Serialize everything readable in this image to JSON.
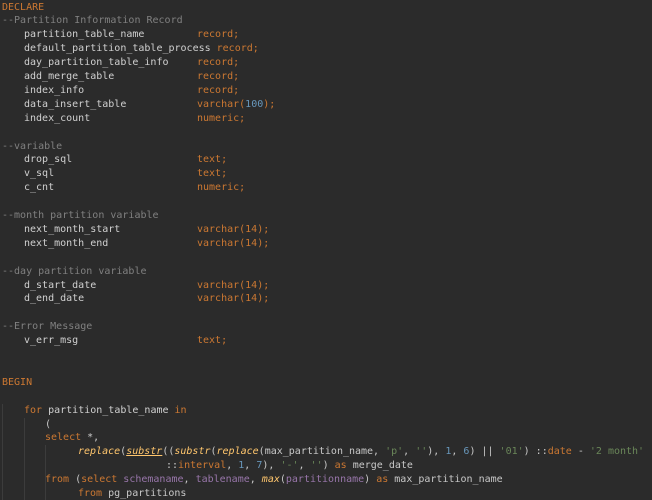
{
  "colors": {
    "background": "#2b2b2b",
    "keyword": "#cc7832",
    "comment": "#808080",
    "identifier": "#d0d0d0",
    "function": "#ffc66d",
    "string": "#6a8759",
    "number": "#6897bb",
    "field": "#9876aa"
  },
  "lines": [
    {
      "indent": 0,
      "tokens": [
        {
          "t": "kw",
          "v": "DECLARE"
        }
      ]
    },
    {
      "indent": 0,
      "tokens": [
        {
          "t": "comment",
          "v": "--Partition Information Record"
        }
      ]
    },
    {
      "indent": 1,
      "tokens": [
        {
          "t": "ident",
          "v": "partition_table_name"
        },
        {
          "t": "pad",
          "v": "record"
        },
        {
          "t": "type",
          "v": "record;"
        }
      ]
    },
    {
      "indent": 1,
      "tokens": [
        {
          "t": "ident",
          "v": "default_partition_table_process"
        },
        {
          "t": "pad",
          "v": "record"
        },
        {
          "t": "type",
          "v": "record;"
        }
      ]
    },
    {
      "indent": 1,
      "tokens": [
        {
          "t": "ident",
          "v": "day_partition_table_info"
        },
        {
          "t": "pad",
          "v": "record"
        },
        {
          "t": "type",
          "v": "record;"
        }
      ]
    },
    {
      "indent": 1,
      "tokens": [
        {
          "t": "ident",
          "v": "add_merge_table"
        },
        {
          "t": "pad",
          "v": "record"
        },
        {
          "t": "type",
          "v": "record;"
        }
      ]
    },
    {
      "indent": 1,
      "tokens": [
        {
          "t": "ident",
          "v": "index_info"
        },
        {
          "t": "pad",
          "v": "record"
        },
        {
          "t": "type",
          "v": "record;"
        }
      ]
    },
    {
      "indent": 1,
      "tokens": [
        {
          "t": "ident",
          "v": "data_insert_table"
        },
        {
          "t": "pad",
          "v": "record"
        },
        {
          "t": "type",
          "v": "varchar("
        },
        {
          "t": "num",
          "v": "100"
        },
        {
          "t": "type",
          "v": ");"
        }
      ]
    },
    {
      "indent": 1,
      "tokens": [
        {
          "t": "ident",
          "v": "index_count"
        },
        {
          "t": "pad",
          "v": "record"
        },
        {
          "t": "type",
          "v": "numeric;"
        }
      ]
    },
    {
      "indent": 0,
      "tokens": []
    },
    {
      "indent": 0,
      "tokens": [
        {
          "t": "comment",
          "v": "--variable"
        }
      ]
    },
    {
      "indent": 1,
      "tokens": [
        {
          "t": "ident",
          "v": "drop_sql"
        },
        {
          "t": "pad",
          "v": "record"
        },
        {
          "t": "type",
          "v": "text;"
        }
      ]
    },
    {
      "indent": 1,
      "tokens": [
        {
          "t": "ident",
          "v": "v_sql"
        },
        {
          "t": "pad",
          "v": "record"
        },
        {
          "t": "type",
          "v": "text;"
        }
      ]
    },
    {
      "indent": 1,
      "tokens": [
        {
          "t": "ident",
          "v": "c_cnt"
        },
        {
          "t": "pad",
          "v": "record"
        },
        {
          "t": "type",
          "v": "numeric;"
        }
      ]
    },
    {
      "indent": 0,
      "tokens": []
    },
    {
      "indent": 0,
      "tokens": [
        {
          "t": "comment",
          "v": "--month partition variable"
        }
      ]
    },
    {
      "indent": 1,
      "tokens": [
        {
          "t": "ident",
          "v": "next_month_start"
        },
        {
          "t": "pad",
          "v": "record"
        },
        {
          "t": "type",
          "v": "varchar(14);"
        }
      ]
    },
    {
      "indent": 1,
      "tokens": [
        {
          "t": "ident",
          "v": "next_month_end"
        },
        {
          "t": "pad",
          "v": "record"
        },
        {
          "t": "type",
          "v": "varchar(14);"
        }
      ]
    },
    {
      "indent": 0,
      "tokens": []
    },
    {
      "indent": 0,
      "tokens": [
        {
          "t": "comment",
          "v": "--day partition variable"
        }
      ]
    },
    {
      "indent": 1,
      "tokens": [
        {
          "t": "ident",
          "v": "d_start_date"
        },
        {
          "t": "pad",
          "v": "record"
        },
        {
          "t": "type",
          "v": "varchar(14);"
        }
      ]
    },
    {
      "indent": 1,
      "tokens": [
        {
          "t": "ident",
          "v": "d_end_date"
        },
        {
          "t": "pad",
          "v": "record"
        },
        {
          "t": "type",
          "v": "varchar(14);"
        }
      ]
    },
    {
      "indent": 0,
      "tokens": []
    },
    {
      "indent": 0,
      "tokens": [
        {
          "t": "comment",
          "v": "--Error Message"
        }
      ]
    },
    {
      "indent": 1,
      "tokens": [
        {
          "t": "ident",
          "v": "v_err_msg"
        },
        {
          "t": "pad",
          "v": "record"
        },
        {
          "t": "type",
          "v": "text;"
        }
      ]
    },
    {
      "indent": 0,
      "tokens": []
    },
    {
      "indent": 0,
      "tokens": []
    },
    {
      "indent": 0,
      "tokens": [
        {
          "t": "kw",
          "v": "BEGIN"
        }
      ]
    },
    {
      "indent": 0,
      "tokens": []
    },
    {
      "indent": 1,
      "tokens": [
        {
          "t": "kw",
          "v": "for "
        },
        {
          "t": "ident",
          "v": "partition_table_name "
        },
        {
          "t": "kw",
          "v": "in"
        }
      ]
    },
    {
      "indent": 2,
      "tokens": [
        {
          "t": "plain",
          "v": "("
        }
      ]
    },
    {
      "indent": 2,
      "tokens": [
        {
          "t": "kw",
          "v": "select "
        },
        {
          "t": "plain",
          "v": "*,"
        }
      ]
    },
    {
      "indent": 3,
      "tokens": [
        {
          "t": "fn",
          "v": "replace"
        },
        {
          "t": "plain",
          "v": "("
        },
        {
          "t": "fnu",
          "v": "substr"
        },
        {
          "t": "plain",
          "v": "(("
        },
        {
          "t": "fn",
          "v": "substr"
        },
        {
          "t": "plain",
          "v": "("
        },
        {
          "t": "fn",
          "v": "replace"
        },
        {
          "t": "plain",
          "v": "(max_partition_name, "
        },
        {
          "t": "str",
          "v": "'p'"
        },
        {
          "t": "plain",
          "v": ", "
        },
        {
          "t": "str",
          "v": "''"
        },
        {
          "t": "plain",
          "v": "), "
        },
        {
          "t": "num",
          "v": "1"
        },
        {
          "t": "plain",
          "v": ", "
        },
        {
          "t": "num",
          "v": "6"
        },
        {
          "t": "plain",
          "v": ") || "
        },
        {
          "t": "str",
          "v": "'01'"
        },
        {
          "t": "plain",
          "v": ") ::"
        },
        {
          "t": "type",
          "v": "date"
        },
        {
          "t": "plain",
          "v": " - "
        },
        {
          "t": "str",
          "v": "'2 month'"
        }
      ]
    },
    {
      "indent": 5,
      "tokens": [
        {
          "t": "plain",
          "v": "::"
        },
        {
          "t": "type",
          "v": "interval"
        },
        {
          "t": "plain",
          "v": ", "
        },
        {
          "t": "num",
          "v": "1"
        },
        {
          "t": "plain",
          "v": ", "
        },
        {
          "t": "num",
          "v": "7"
        },
        {
          "t": "plain",
          "v": "), "
        },
        {
          "t": "str",
          "v": "'-'"
        },
        {
          "t": "plain",
          "v": ", "
        },
        {
          "t": "str",
          "v": "''"
        },
        {
          "t": "plain",
          "v": ") "
        },
        {
          "t": "kw",
          "v": "as "
        },
        {
          "t": "plain",
          "v": "merge_date"
        }
      ]
    },
    {
      "indent": 2,
      "tokens": [
        {
          "t": "kw",
          "v": "from "
        },
        {
          "t": "plain",
          "v": "("
        },
        {
          "t": "kw",
          "v": "select "
        },
        {
          "t": "purple",
          "v": "schemaname"
        },
        {
          "t": "plain",
          "v": ", "
        },
        {
          "t": "purple",
          "v": "tablename"
        },
        {
          "t": "plain",
          "v": ", "
        },
        {
          "t": "fn",
          "v": "max"
        },
        {
          "t": "plain",
          "v": "("
        },
        {
          "t": "purple",
          "v": "partitionname"
        },
        {
          "t": "plain",
          "v": ") "
        },
        {
          "t": "kw",
          "v": "as "
        },
        {
          "t": "plain",
          "v": "max_partition_name"
        }
      ]
    },
    {
      "indent": 3,
      "tokens": [
        {
          "t": "kw",
          "v": "from "
        },
        {
          "t": "plain",
          "v": "pg_partitions"
        }
      ]
    }
  ]
}
